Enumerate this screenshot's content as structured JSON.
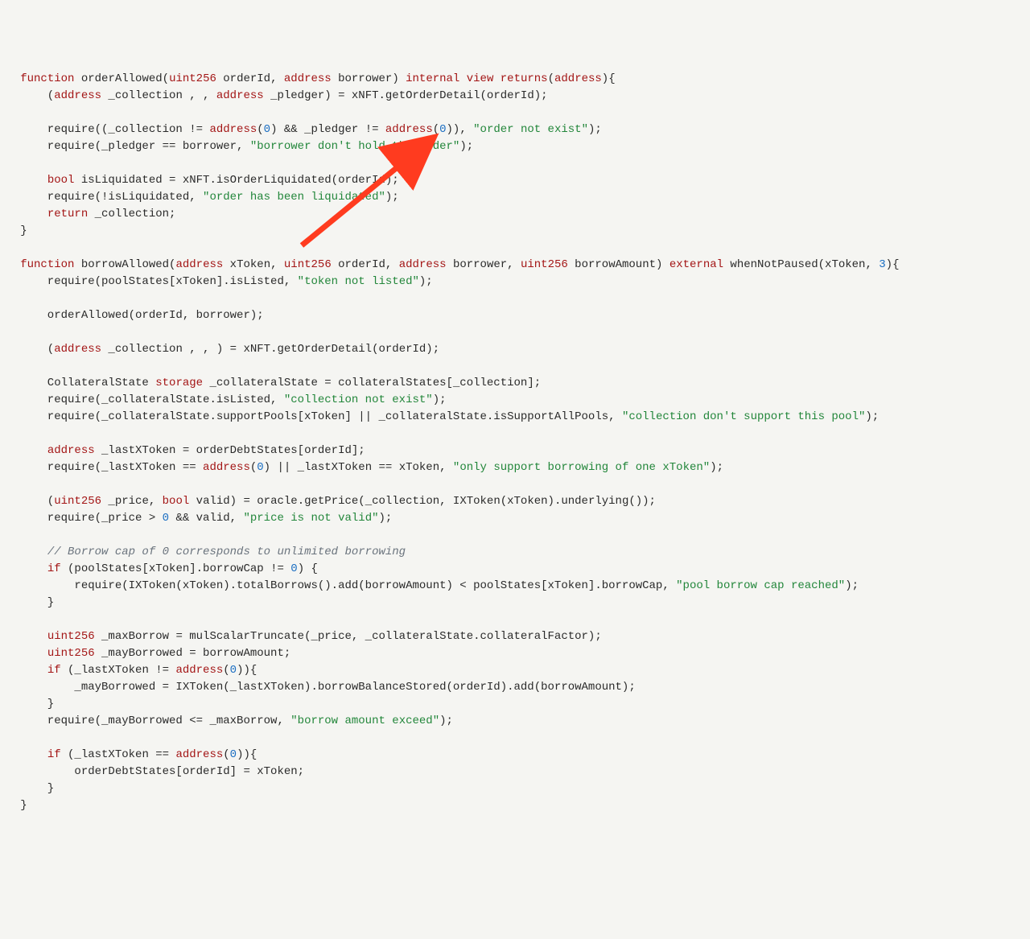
{
  "kw": {
    "function": "function",
    "internal": "internal",
    "view": "view",
    "returns": "returns",
    "address": "address",
    "bool": "bool",
    "return": "return",
    "uint256": "uint256",
    "external": "external",
    "storage": "storage",
    "if": "if"
  },
  "s": {
    "order_not_exist": "\"order not exist\"",
    "borrower_no_hold": "\"borrower don't hold the order\"",
    "order_liquidated": "\"order has been liquidated\"",
    "token_not_listed": "\"token not listed\"",
    "collection_not_exist": "\"collection not exist\"",
    "collection_no_support": "\"collection don't support this pool\"",
    "only_one_xtoken": "\"only support borrowing of one xToken\"",
    "price_not_valid": "\"price is not valid\"",
    "pool_cap_reached": "\"pool borrow cap reached\"",
    "borrow_exceed": "\"borrow amount exceed\""
  },
  "n": {
    "zero": "0",
    "three": "3"
  },
  "cmt": {
    "borrow_cap": "// Borrow cap of 0 corresponds to unlimited borrowing"
  },
  "t": {
    "l1a": "   ",
    "fn1_sig_a": " orderAllowed(",
    "fn1_sig_b": " orderId, ",
    "fn1_sig_c": " borrower) ",
    "fn1_sig_d": " ",
    "fn1_sig_e": "(",
    "fn1_sig_f": "){",
    "l2": "       (",
    "l2b": " _collection , , ",
    "l2c": " _pledger) = xNFT.getOrderDetail(orderId);",
    "l4a": "       require((_collection != ",
    "l4b": "(",
    "l4c": ") && _pledger != ",
    "l4d": "(",
    "l4e": ")), ",
    "l4f": ");",
    "l5a": "       require(_pledger == borrower, ",
    "l5b": ");",
    "l7a": "       ",
    "l7b": " isLiquidated = xNFT.isOrderLiquidated(orderId);",
    "l8a": "       require(!isLiquidated, ",
    "l8b": ");",
    "l9a": "       ",
    "l9b": " _collection;",
    "l10": "   }",
    "fn2_sig_a": " borrowAllowed(",
    "fn2_sig_b": " xToken, ",
    "fn2_sig_c": " orderId, ",
    "fn2_sig_d": " borrower, ",
    "fn2_sig_e": " borrowAmount) ",
    "fn2_sig_f": " whenNotPaused(xToken, ",
    "fn2_sig_g": "){",
    "l13a": "       require(poolStates[xToken].isListed, ",
    "l13b": ");",
    "l15": "       orderAllowed(orderId, borrower);",
    "l17a": "       (",
    "l17b": " _collection , , ) = xNFT.getOrderDetail(orderId);",
    "l19a": "       CollateralState ",
    "l19b": " _collateralState = collateralStates[_collection];",
    "l20a": "       require(_collateralState.isListed, ",
    "l20b": ");",
    "l21a": "       require(_collateralState.supportPools[xToken] || _collateralState.isSupportAllPools, ",
    "l21b": ");",
    "l23a": "       ",
    "l23b": " _lastXToken = orderDebtStates[orderId];",
    "l24a": "       require(_lastXToken == ",
    "l24b": "(",
    "l24c": ") || _lastXToken == xToken, ",
    "l24d": ");",
    "l26a": "       (",
    "l26b": " _price, ",
    "l26c": " valid) = oracle.getPrice(_collection, IXToken(xToken).underlying());",
    "l27a": "       require(_price > ",
    "l27b": " && valid, ",
    "l27c": ");",
    "l29": "       ",
    "l30a": "       ",
    "l30b": " (poolStates[xToken].borrowCap != ",
    "l30c": ") {",
    "l31a": "           require(IXToken(xToken).totalBorrows().add(borrowAmount) < poolStates[xToken].borrowCap, ",
    "l31b": ");",
    "l32": "       }",
    "l34a": "       ",
    "l34b": " _maxBorrow = mulScalarTruncate(_price, _collateralState.collateralFactor);",
    "l35a": "       ",
    "l35b": " _mayBorrowed = borrowAmount;",
    "l36a": "       ",
    "l36b": " (_lastXToken != ",
    "l36c": "(",
    "l36d": ")){",
    "l37": "           _mayBorrowed = IXToken(_lastXToken).borrowBalanceStored(orderId).add(borrowAmount);",
    "l38": "       }",
    "l39a": "       require(_mayBorrowed <= _maxBorrow, ",
    "l39b": ");",
    "l41a": "       ",
    "l41b": " (_lastXToken == ",
    "l41c": "(",
    "l41d": ")){",
    "l42": "           orderDebtStates[orderId] = xToken;",
    "l43": "       }",
    "l44": "   }"
  }
}
